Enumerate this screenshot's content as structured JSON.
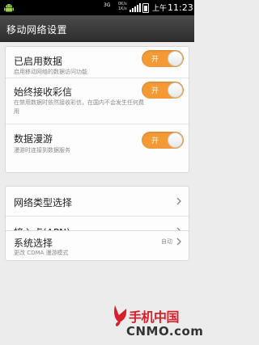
{
  "status_bar": {
    "network": "3G",
    "speed_up": "0K/s",
    "speed_down": "1K/s",
    "time_period": "上午",
    "time": "11:23",
    "icons": [
      "android-icon",
      "signal-icon",
      "battery-icon"
    ]
  },
  "header": {
    "title": "移动网络设置"
  },
  "data_group": {
    "items": [
      {
        "title": "已启用数据",
        "subtitle": "启用移动网络的数据访问功能",
        "toggle_label": "开",
        "toggle_on": true
      },
      {
        "title": "始终接收彩信",
        "subtitle": "在禁用数据时依然接收彩信，在国内不会发生任何费用",
        "toggle_label": "开",
        "toggle_on": true
      },
      {
        "title": "数据漫游",
        "subtitle": "漫游时连接到数据服务",
        "toggle_label": "开",
        "toggle_on": true
      }
    ]
  },
  "network_group": {
    "items": [
      {
        "title": "网络类型选择"
      },
      {
        "title": "接入点(APN)"
      }
    ]
  },
  "system_group": {
    "title": "系统选择",
    "subtitle": "更改 CDMA 漫游模式",
    "value": "自动"
  },
  "watermark": {
    "brand_cn": "手机中国",
    "brand_en": "CNMO.com"
  },
  "colors": {
    "accent": "#f39a37",
    "title_bar": "#3a3a3a",
    "background": "#ececec"
  }
}
